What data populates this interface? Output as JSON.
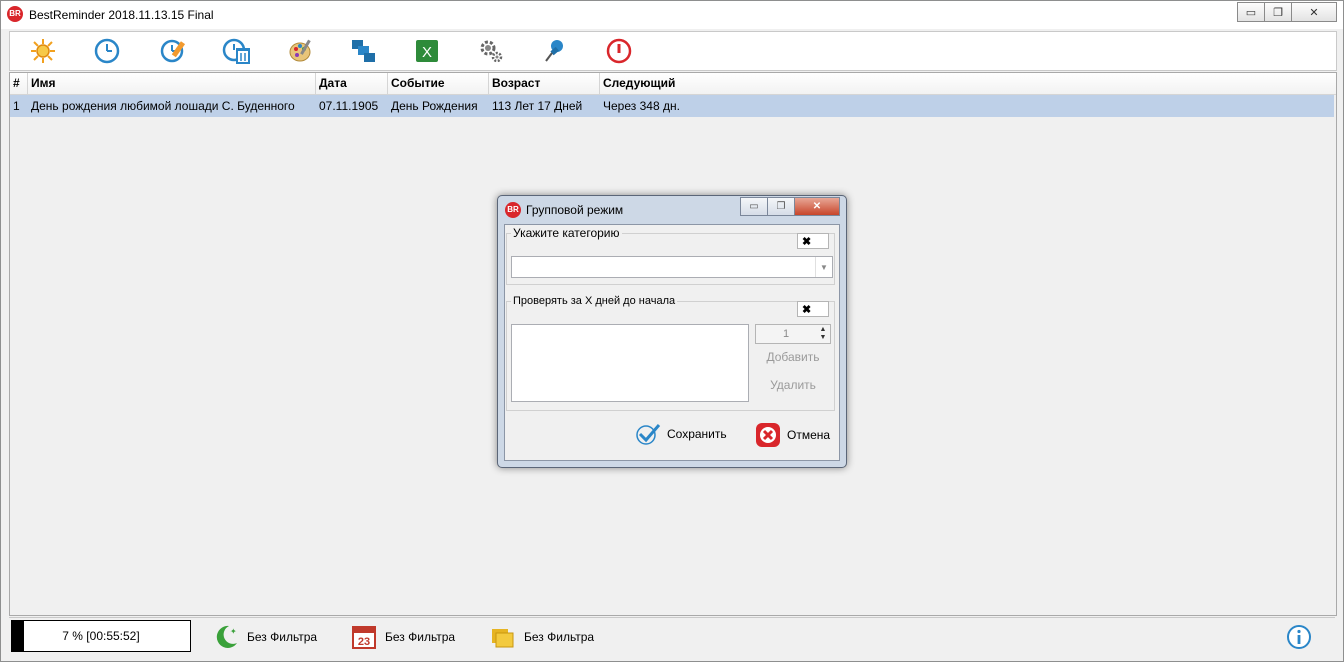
{
  "window": {
    "app_icon_text": "BR",
    "title": "BestReminder 2018.11.13.15 Final",
    "btn_minimize": "▭",
    "btn_restore": "❐",
    "btn_close": "✕"
  },
  "toolbar": {
    "icons": [
      "sun-gear-icon",
      "clock-icon",
      "clock-edit-icon",
      "clock-delete-icon",
      "palette-icon",
      "windows-tiles-icon",
      "excel-icon",
      "settings-gears-icon",
      "pin-icon",
      "power-icon"
    ]
  },
  "grid": {
    "columns": [
      "#",
      "Имя",
      "Дата",
      "Событие",
      "Возраст",
      "Следующий"
    ],
    "rows": [
      {
        "num": "1",
        "name": "День рождения любимой лошади С. Буденного",
        "date": "07.11.1905",
        "event": "День Рождения",
        "age": "113 Лет 17 Дней",
        "next": "Через 348 дн."
      }
    ]
  },
  "dialog": {
    "icon_text": "BR",
    "title": "Групповой режим",
    "category_group_label": "Укажите категорию",
    "category_clear": "✖",
    "category_value": "",
    "days_group_label": "Проверять за X дней до начала",
    "days_clear": "✖",
    "spin_value": "1",
    "add_label": "Добавить",
    "delete_label": "Удалить",
    "save_label": "Сохранить",
    "cancel_label": "Отмена"
  },
  "status": {
    "progress_text": "7 % [00:55:52]",
    "progress_fraction": 0.07,
    "filter1": "Без Фильтра",
    "filter2": "Без Фильтра",
    "filter2_calendar_day": "23",
    "filter3": "Без Фильтра"
  },
  "colors": {
    "selected_row": "#bed0e8",
    "accent_red": "#d9262b",
    "excel_green": "#2e8b3a"
  }
}
